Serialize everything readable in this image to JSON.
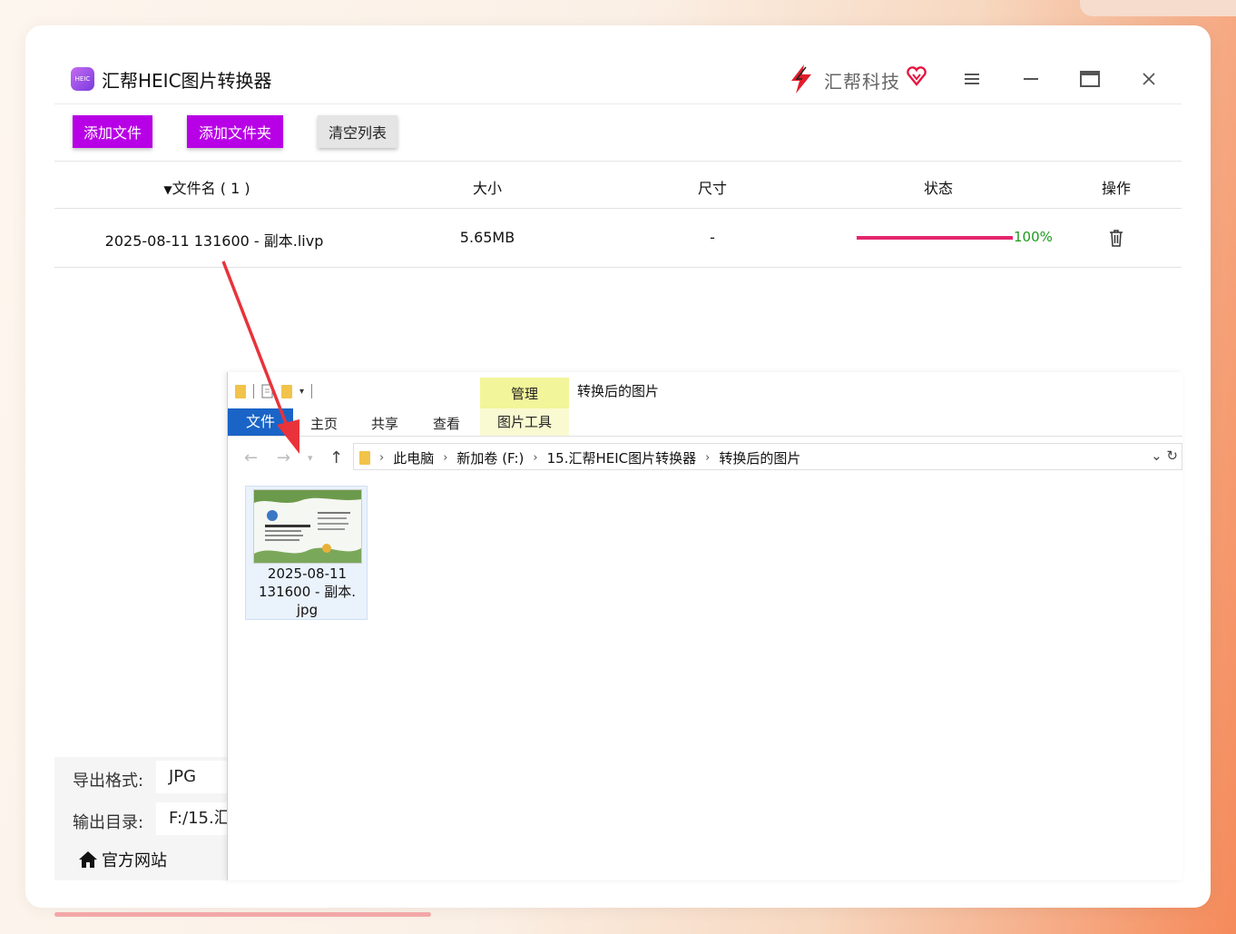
{
  "app": {
    "title": "汇帮HEIC图片转换器",
    "logo_text": "HEIC",
    "brand_name": "汇帮科技"
  },
  "toolbar": {
    "add_file": "添加文件",
    "add_folder": "添加文件夹",
    "clear_list": "清空列表"
  },
  "table": {
    "headers": {
      "name": "文件名 ( 1 )",
      "size": "大小",
      "dimensions": "尺寸",
      "status": "状态",
      "action": "操作"
    },
    "rows": [
      {
        "name": "2025-08-11 131600 - 副本.livp",
        "size": "5.65MB",
        "dimensions": "-",
        "progress": 1.0,
        "progress_text": "100%"
      }
    ]
  },
  "settings": {
    "format_label": "导出格式:",
    "format_value": "JPG",
    "output_label": "输出目录:",
    "output_value": "F:/15.汇",
    "site_link": "官方网站"
  },
  "explorer": {
    "manage_tab": "管理",
    "window_title": "转换后的图片",
    "ribbon_tabs": {
      "file": "文件",
      "home": "主页",
      "share": "共享",
      "view": "查看",
      "picture_tools": "图片工具"
    },
    "breadcrumbs": [
      "此电脑",
      "新加卷 (F:)",
      "15.汇帮HEIC图片转换器",
      "转换后的图片"
    ],
    "files": [
      {
        "name_line1": "2025-08-11",
        "name_line2": "131600 - 副本.",
        "name_line3": "jpg"
      }
    ]
  },
  "colors": {
    "accent_purple": "#b800e6",
    "progress": "#e3266b",
    "success_text": "#1c9c1c",
    "explorer_file_tab": "#1a64c7",
    "annotation_arrow": "#e8333b"
  }
}
